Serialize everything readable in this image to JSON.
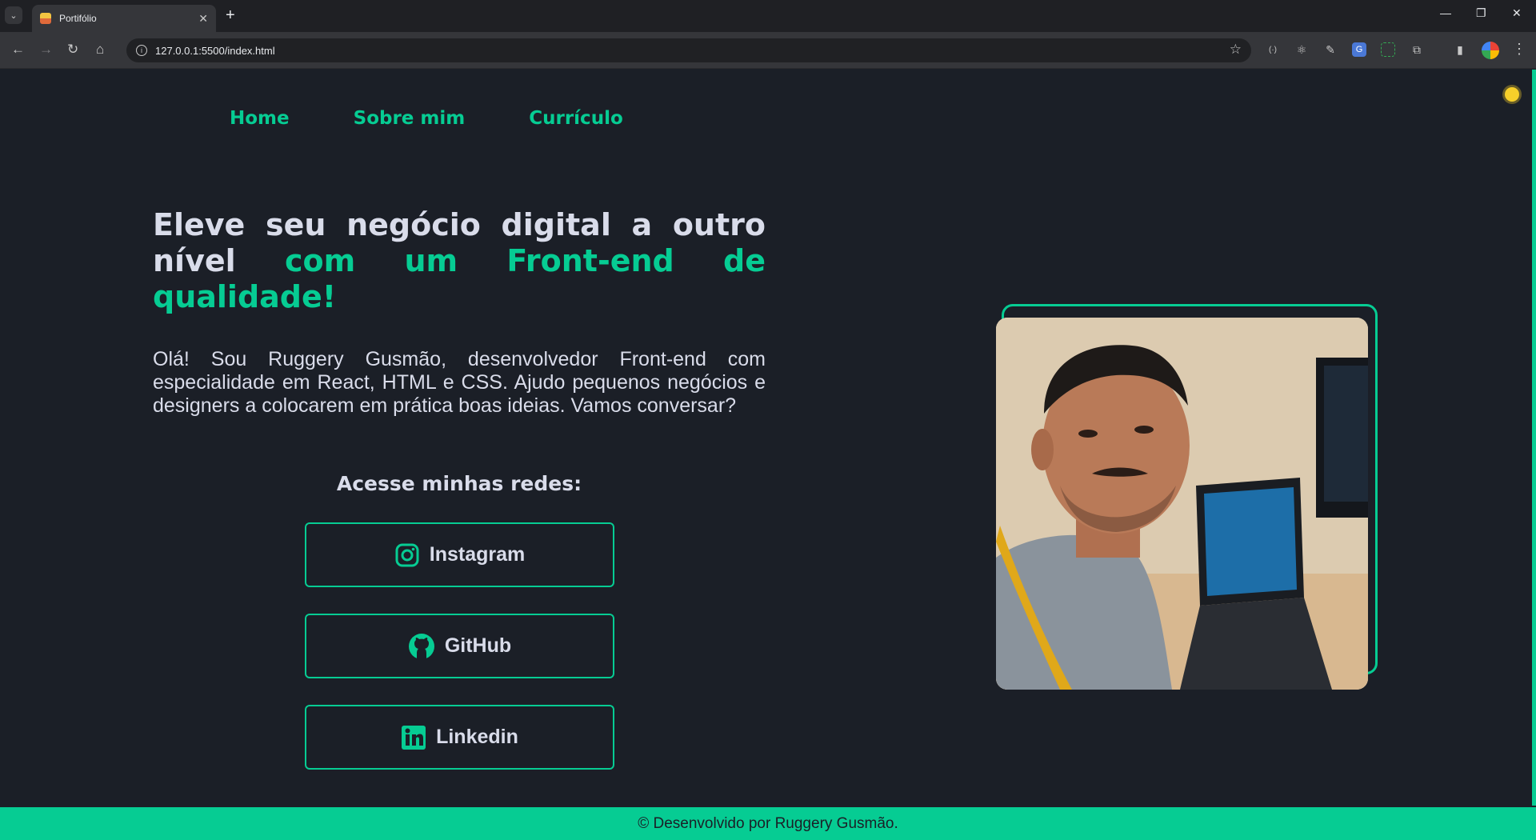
{
  "browser": {
    "tab_title": "Portifólio",
    "url": "127.0.0.1:5500/index.html",
    "new_tab": "+",
    "close": "✕"
  },
  "nav": {
    "items": [
      "Home",
      "Sobre mim",
      "Currículo"
    ]
  },
  "hero": {
    "headline_plain": "Eleve seu negócio digital a outro nível",
    "headline_accent": "com um Front-end de qualidade!",
    "bio": "Olá! Sou Ruggery Gusmão, desenvolvedor Front-end com especialidade em React, HTML e CSS. Ajudo pequenos negócios e designers a colocarem em prática boas ideias. Vamos conversar?",
    "networks_title": "Acesse minhas redes:"
  },
  "social": [
    {
      "label": "Instagram",
      "icon": "instagram-icon"
    },
    {
      "label": "GitHub",
      "icon": "github-icon"
    },
    {
      "label": "Linkedin",
      "icon": "linkedin-icon"
    }
  ],
  "footer": {
    "text": "© Desenvolvido por Ruggery Gusmão."
  },
  "colors": {
    "accent": "#06cc93",
    "background": "#1b1f27",
    "text": "#d9dcea",
    "theme_icon": "#f7cf2a"
  }
}
